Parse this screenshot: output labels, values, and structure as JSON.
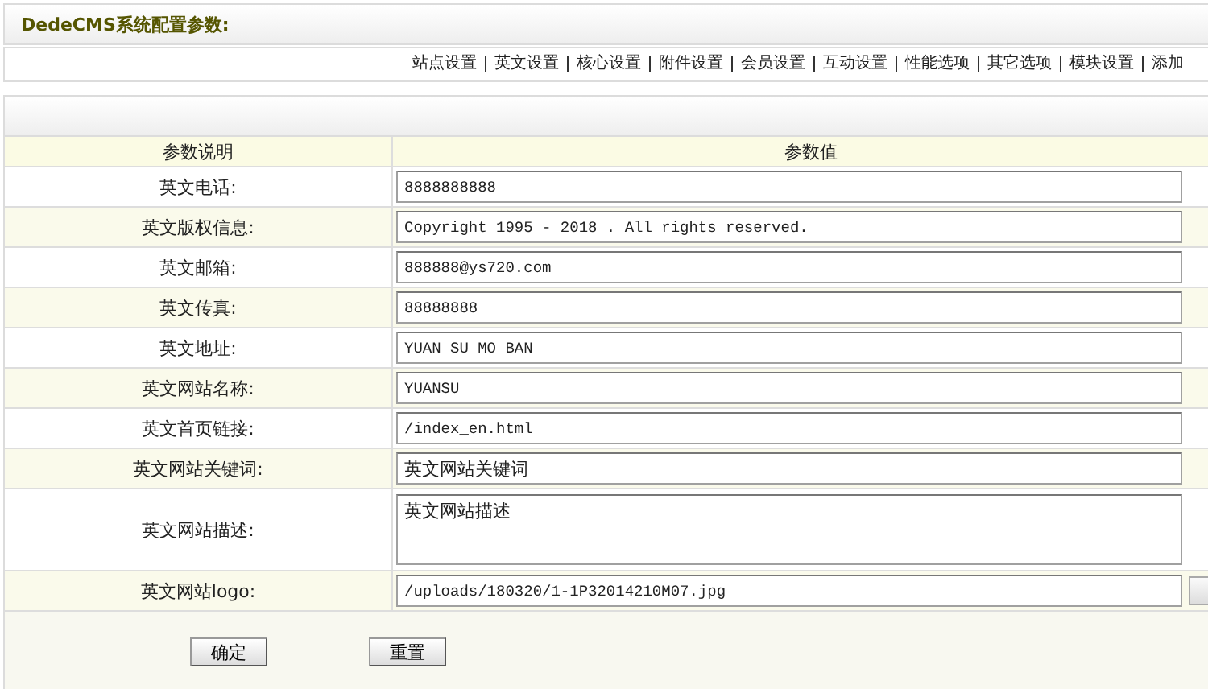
{
  "header": {
    "title": "DedeCMS系统配置参数:"
  },
  "nav": [
    {
      "label": "站点设置"
    },
    {
      "label": "英文设置"
    },
    {
      "label": "核心设置"
    },
    {
      "label": "附件设置"
    },
    {
      "label": "会员设置"
    },
    {
      "label": "互动设置"
    },
    {
      "label": "性能选项"
    },
    {
      "label": "其它选项"
    },
    {
      "label": "模块设置"
    },
    {
      "label": "添加"
    }
  ],
  "table": {
    "columns": [
      "参数说明",
      "参数值"
    ],
    "rows": [
      {
        "kind": "text",
        "label": "英文电话:",
        "value": "8888888888"
      },
      {
        "kind": "text",
        "label": "英文版权信息:",
        "value": "Copyright 1995 - 2018 . All rights reserved."
      },
      {
        "kind": "text",
        "label": "英文邮箱:",
        "value": "888888@ys720.com"
      },
      {
        "kind": "text",
        "label": "英文传真:",
        "value": "88888888"
      },
      {
        "kind": "text",
        "label": "英文地址:",
        "value": "YUAN SU MO BAN"
      },
      {
        "kind": "text",
        "label": "英文网站名称:",
        "value": "YUANSU"
      },
      {
        "kind": "text",
        "label": "英文首页链接:",
        "value": "/index_en.html"
      },
      {
        "kind": "text",
        "label": "英文网站关键词:",
        "value": "英文网站关键词"
      },
      {
        "kind": "textarea",
        "label": "英文网站描述:",
        "value": "英文网站描述"
      },
      {
        "kind": "file",
        "label": "英文网站logo:",
        "value": "/uploads/180320/1-1P32014210M07.jpg"
      }
    ]
  },
  "buttons": [
    "确定",
    "重置"
  ]
}
